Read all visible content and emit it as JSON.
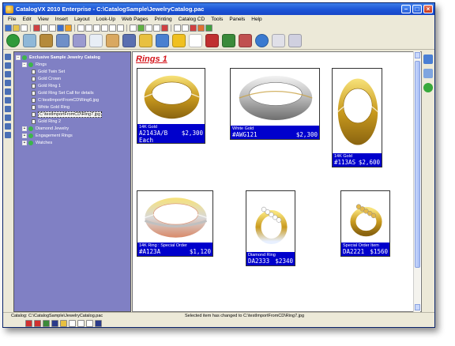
{
  "window": {
    "title": "CatalogVX 2010 Enterprise - C:\\CatalogSample\\JewelryCatalog.pac"
  },
  "menu": [
    "File",
    "Edit",
    "View",
    "Insert",
    "Layout",
    "Look-Up",
    "Web Pages",
    "Printing",
    "Catalog CD",
    "Tools",
    "Panels",
    "Help"
  ],
  "tree": {
    "root": "Exclusive Sample Jewelry Catalog",
    "items": [
      {
        "label": "Rings",
        "level": 1,
        "kind": "folder",
        "expanded": true
      },
      {
        "label": "Gold Twin Set",
        "level": 2,
        "kind": "doc"
      },
      {
        "label": "Gold Crown",
        "level": 2,
        "kind": "doc"
      },
      {
        "label": "Gold Ring 1",
        "level": 2,
        "kind": "doc"
      },
      {
        "label": "Gold Ring Set Call for details",
        "level": 2,
        "kind": "doc"
      },
      {
        "label": "C:\\testImportFromCD\\Ring6.jpg",
        "level": 2,
        "kind": "doc"
      },
      {
        "label": "White Gold Ring",
        "level": 2,
        "kind": "doc"
      },
      {
        "label": "C:\\testImportFromCD\\Ring7.jpg",
        "level": 2,
        "kind": "doc",
        "selected": true
      },
      {
        "label": "Gold Ring 2",
        "level": 2,
        "kind": "doc"
      },
      {
        "label": "Diamond Jewelry",
        "level": 1,
        "kind": "folder"
      },
      {
        "label": "Engagement Rings",
        "level": 1,
        "kind": "folder"
      },
      {
        "label": "Watches",
        "level": 1,
        "kind": "folder"
      }
    ]
  },
  "page": {
    "heading": "Rings 1",
    "products": [
      {
        "sub": "14K Gold",
        "code": "A2143A/B",
        "price": "$2,300",
        "extra": "Each",
        "metal": "gold"
      },
      {
        "sub": "White Gold",
        "code": "#AWG121",
        "price": "$2,300",
        "extra": "",
        "metal": "white"
      },
      {
        "sub": "14K Gold",
        "code": "#113AS",
        "price": "$2,600",
        "extra": "",
        "metal": "gold"
      },
      {
        "sub": "14K Ring : Special Order",
        "code": "#A123A",
        "price": "$1,120",
        "extra": "",
        "metal": "tri"
      },
      {
        "sub": "Diamond Ring",
        "code": "DA2333",
        "price": "$2340",
        "extra": "",
        "metal": "diamond"
      },
      {
        "sub": "Special Order Item",
        "code": "DA2221",
        "price": "$1560",
        "extra": "",
        "metal": "hearts"
      }
    ]
  },
  "status": {
    "catalog": "Catalog: C:\\CatalogSample\\JewelryCatalog.pac",
    "message": "Selected item has changed to C:\\testImportFromCD\\Ring7.jpg"
  },
  "colors": {
    "tree_bg": "#8080c4",
    "caption_bg": "#0000cc",
    "heading": "#d4141a"
  }
}
